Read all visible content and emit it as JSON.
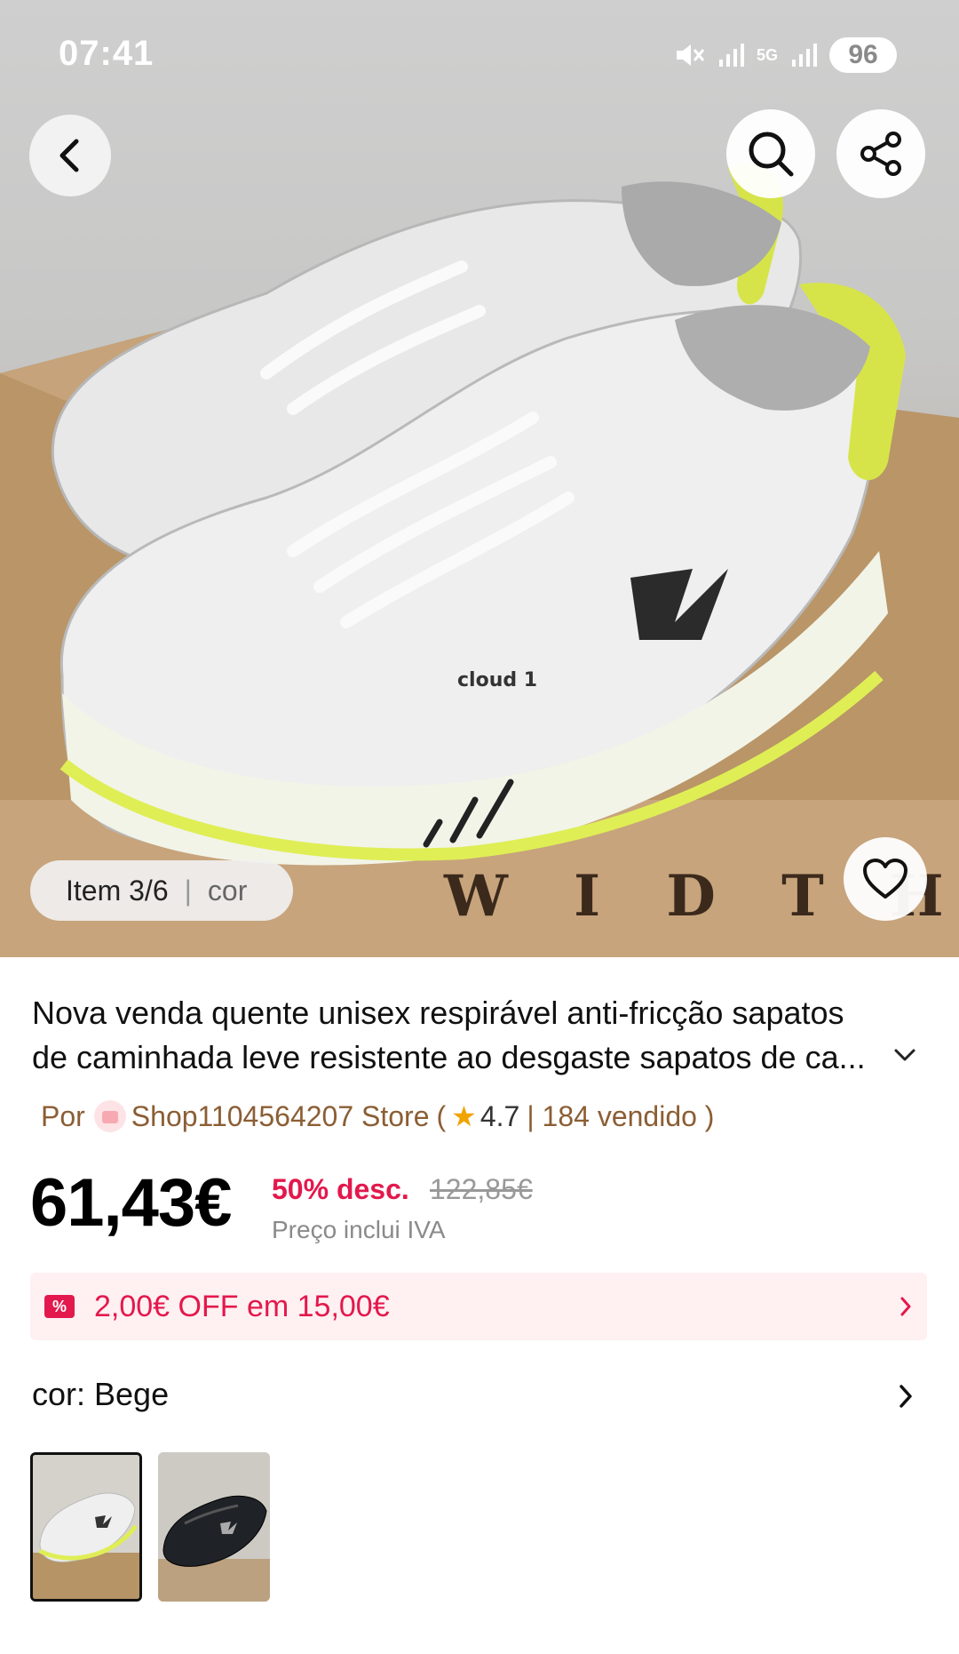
{
  "status_bar": {
    "time": "07:41",
    "network": "5G",
    "battery": "96",
    "icons": [
      "mute-icon",
      "signal-icon",
      "5g-icon",
      "signal-icon"
    ]
  },
  "header": {
    "back_icon": "chevron-left-icon",
    "search_icon": "search-icon",
    "share_icon": "share-icon"
  },
  "gallery": {
    "item_label": "Item 3/6",
    "variant_label": "cor",
    "favorite_icon": "heart-icon"
  },
  "product": {
    "title_line1": "Nova venda quente unisex respirável anti-fricção sapatos",
    "title_line2": "de caminhada leve resistente ao desgaste sapatos de ca...",
    "store_prefix": "Por",
    "store_name": "Shop1104564207 Store",
    "store_open": "(",
    "rating": "4.7",
    "sold": "| 184 vendido )",
    "price": "61,43€",
    "discount": "50% desc.",
    "original_price": "122,85€",
    "vat_note": "Preço inclui IVA"
  },
  "coupon": {
    "icon_text": "%",
    "text": "2,00€ OFF em 15,00€"
  },
  "variants": {
    "label": "cor: Bege",
    "options": [
      "Bege",
      "Preto"
    ],
    "selected": "Bege"
  },
  "colors": {
    "accent": "#e3184c",
    "coupon_bg": "#fff0f2",
    "store_text": "#8b5e34"
  }
}
